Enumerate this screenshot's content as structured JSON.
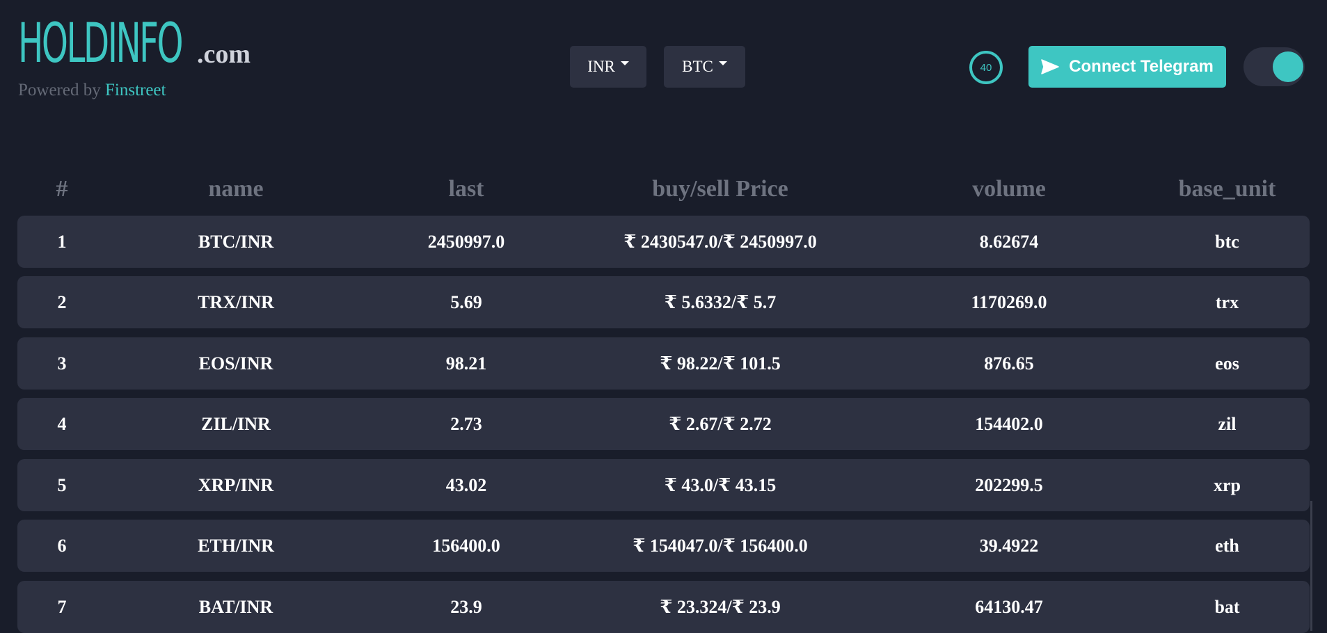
{
  "header": {
    "logo_main": "HOLDINFO",
    "logo_suffix": ".com",
    "powered_by": "Powered by",
    "powered_brand": "Finstreet",
    "currency_dropdown": "INR",
    "coin_dropdown": "BTC",
    "counter": "40",
    "telegram_button": "Connect Telegram",
    "theme_toggle_on": true
  },
  "colors": {
    "accent": "#3ec6c2",
    "background": "#191d2a",
    "row_background": "#2d3141",
    "header_text": "#6e7380"
  },
  "icons": {
    "telegram": "paper-plane-icon",
    "dropdown": "caret-down-icon"
  },
  "table": {
    "columns": [
      "#",
      "name",
      "last",
      "buy/sell Price",
      "volume",
      "base_unit"
    ],
    "rows": [
      [
        "1",
        "BTC/INR",
        "2450997.0",
        "₹ 2430547.0/₹ 2450997.0",
        "8.62674",
        "btc"
      ],
      [
        "2",
        "TRX/INR",
        "5.69",
        "₹ 5.6332/₹ 5.7",
        "1170269.0",
        "trx"
      ],
      [
        "3",
        "EOS/INR",
        "98.21",
        "₹ 98.22/₹ 101.5",
        "876.65",
        "eos"
      ],
      [
        "4",
        "ZIL/INR",
        "2.73",
        "₹ 2.67/₹ 2.72",
        "154402.0",
        "zil"
      ],
      [
        "5",
        "XRP/INR",
        "43.02",
        "₹ 43.0/₹ 43.15",
        "202299.5",
        "xrp"
      ],
      [
        "6",
        "ETH/INR",
        "156400.0",
        "₹ 154047.0/₹ 156400.0",
        "39.4922",
        "eth"
      ],
      [
        "7",
        "BAT/INR",
        "23.9",
        "₹ 23.324/₹ 23.9",
        "64130.47",
        "bat"
      ]
    ]
  }
}
